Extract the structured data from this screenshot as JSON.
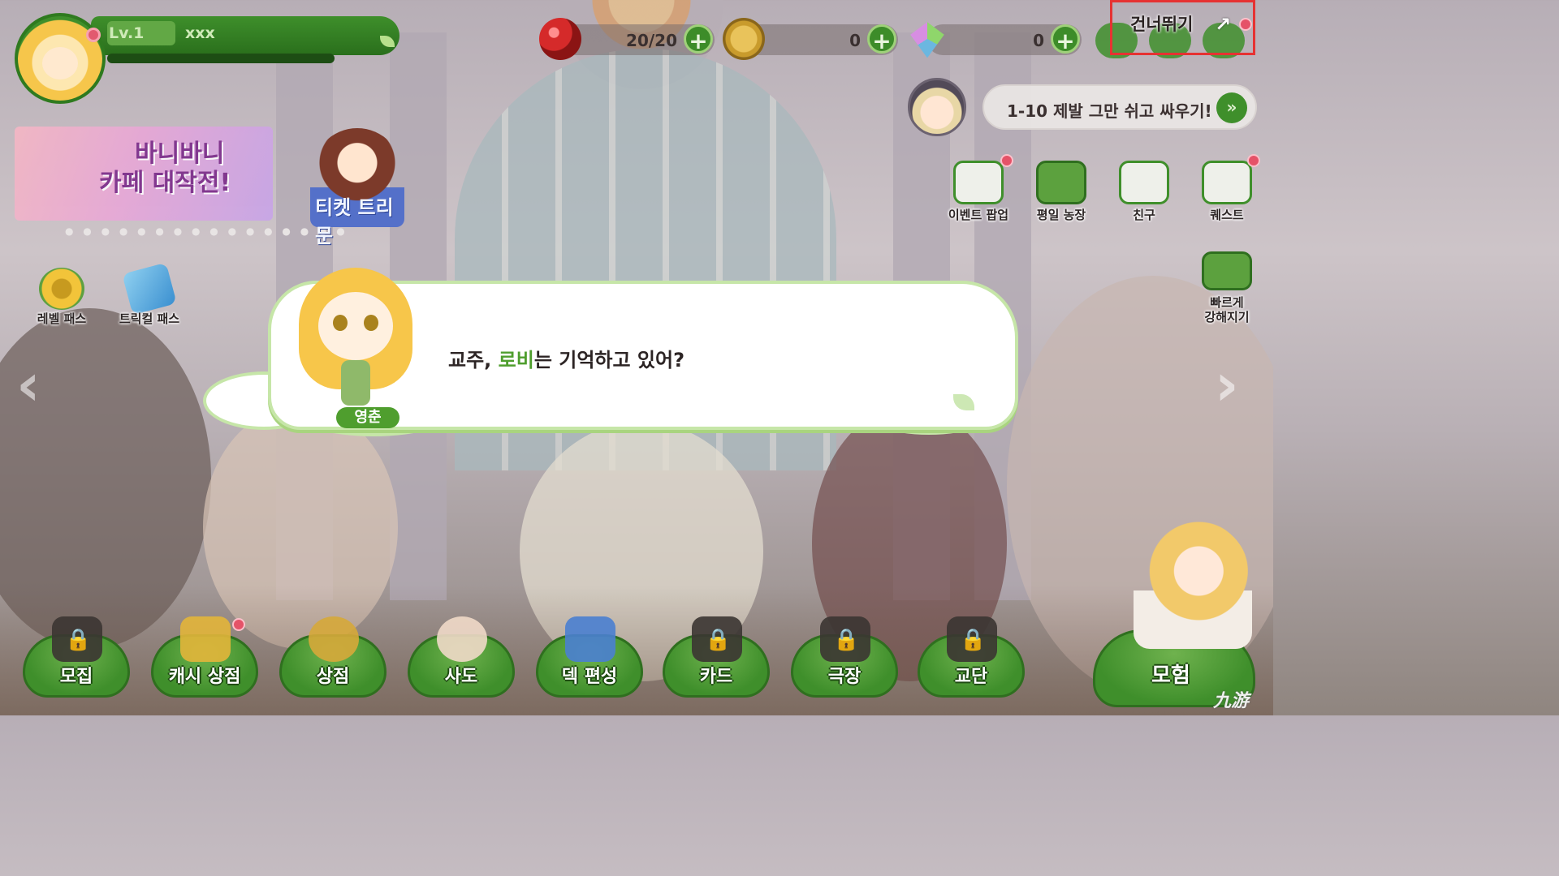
{
  "profile": {
    "level": "Lv.1",
    "name": "xxx",
    "exp_fraction": 0
  },
  "currencies": [
    {
      "icon": "ruby-orb-icon",
      "value": "20/20"
    },
    {
      "icon": "gold-coin-icon",
      "value": "0"
    },
    {
      "icon": "crystal-gem-icon",
      "value": "0"
    }
  ],
  "skip": {
    "label": "건너뛰기"
  },
  "quest": {
    "text": "1-10 제발 그만 쉬고 싸우기!"
  },
  "side_menu": [
    {
      "label": "이벤트 팝업",
      "icon": "event-popup-icon"
    },
    {
      "label": "평일 농장",
      "icon": "farm-icon"
    },
    {
      "label": "친구",
      "icon": "friends-icon"
    },
    {
      "label": "퀘스트",
      "icon": "quest-icon"
    }
  ],
  "quick_power": {
    "label_line1": "빠르게",
    "label_line2": "강해지기"
  },
  "event_banner": {
    "line1": "바니바니",
    "line2": "카페 대작전!"
  },
  "ticket_banner": {
    "text": "티켓 트리문"
  },
  "passes": [
    {
      "label": "레벨 패스",
      "icon": "sunflower-icon"
    },
    {
      "label": "트릭컬 패스",
      "icon": "ticket-icon"
    }
  ],
  "dialogue": {
    "prefix": "교주, ",
    "highlight": "로비",
    "suffix": "는 기억하고 있어?",
    "speaker": "영춘"
  },
  "bottom_nav": [
    {
      "label": "모집",
      "locked": true
    },
    {
      "label": "캐시 상점",
      "locked": false
    },
    {
      "label": "상점",
      "locked": false
    },
    {
      "label": "사도",
      "locked": false
    },
    {
      "label": "덱 편성",
      "locked": false
    },
    {
      "label": "카드",
      "locked": true
    },
    {
      "label": "극장",
      "locked": true
    },
    {
      "label": "교단",
      "locked": true
    }
  ],
  "adventure": {
    "label": "모험"
  },
  "watermark": "九游",
  "colors": {
    "accent_green": "#3f8f2b",
    "highlight_green": "#4f9e2e",
    "skip_highlight": "#e63232"
  }
}
